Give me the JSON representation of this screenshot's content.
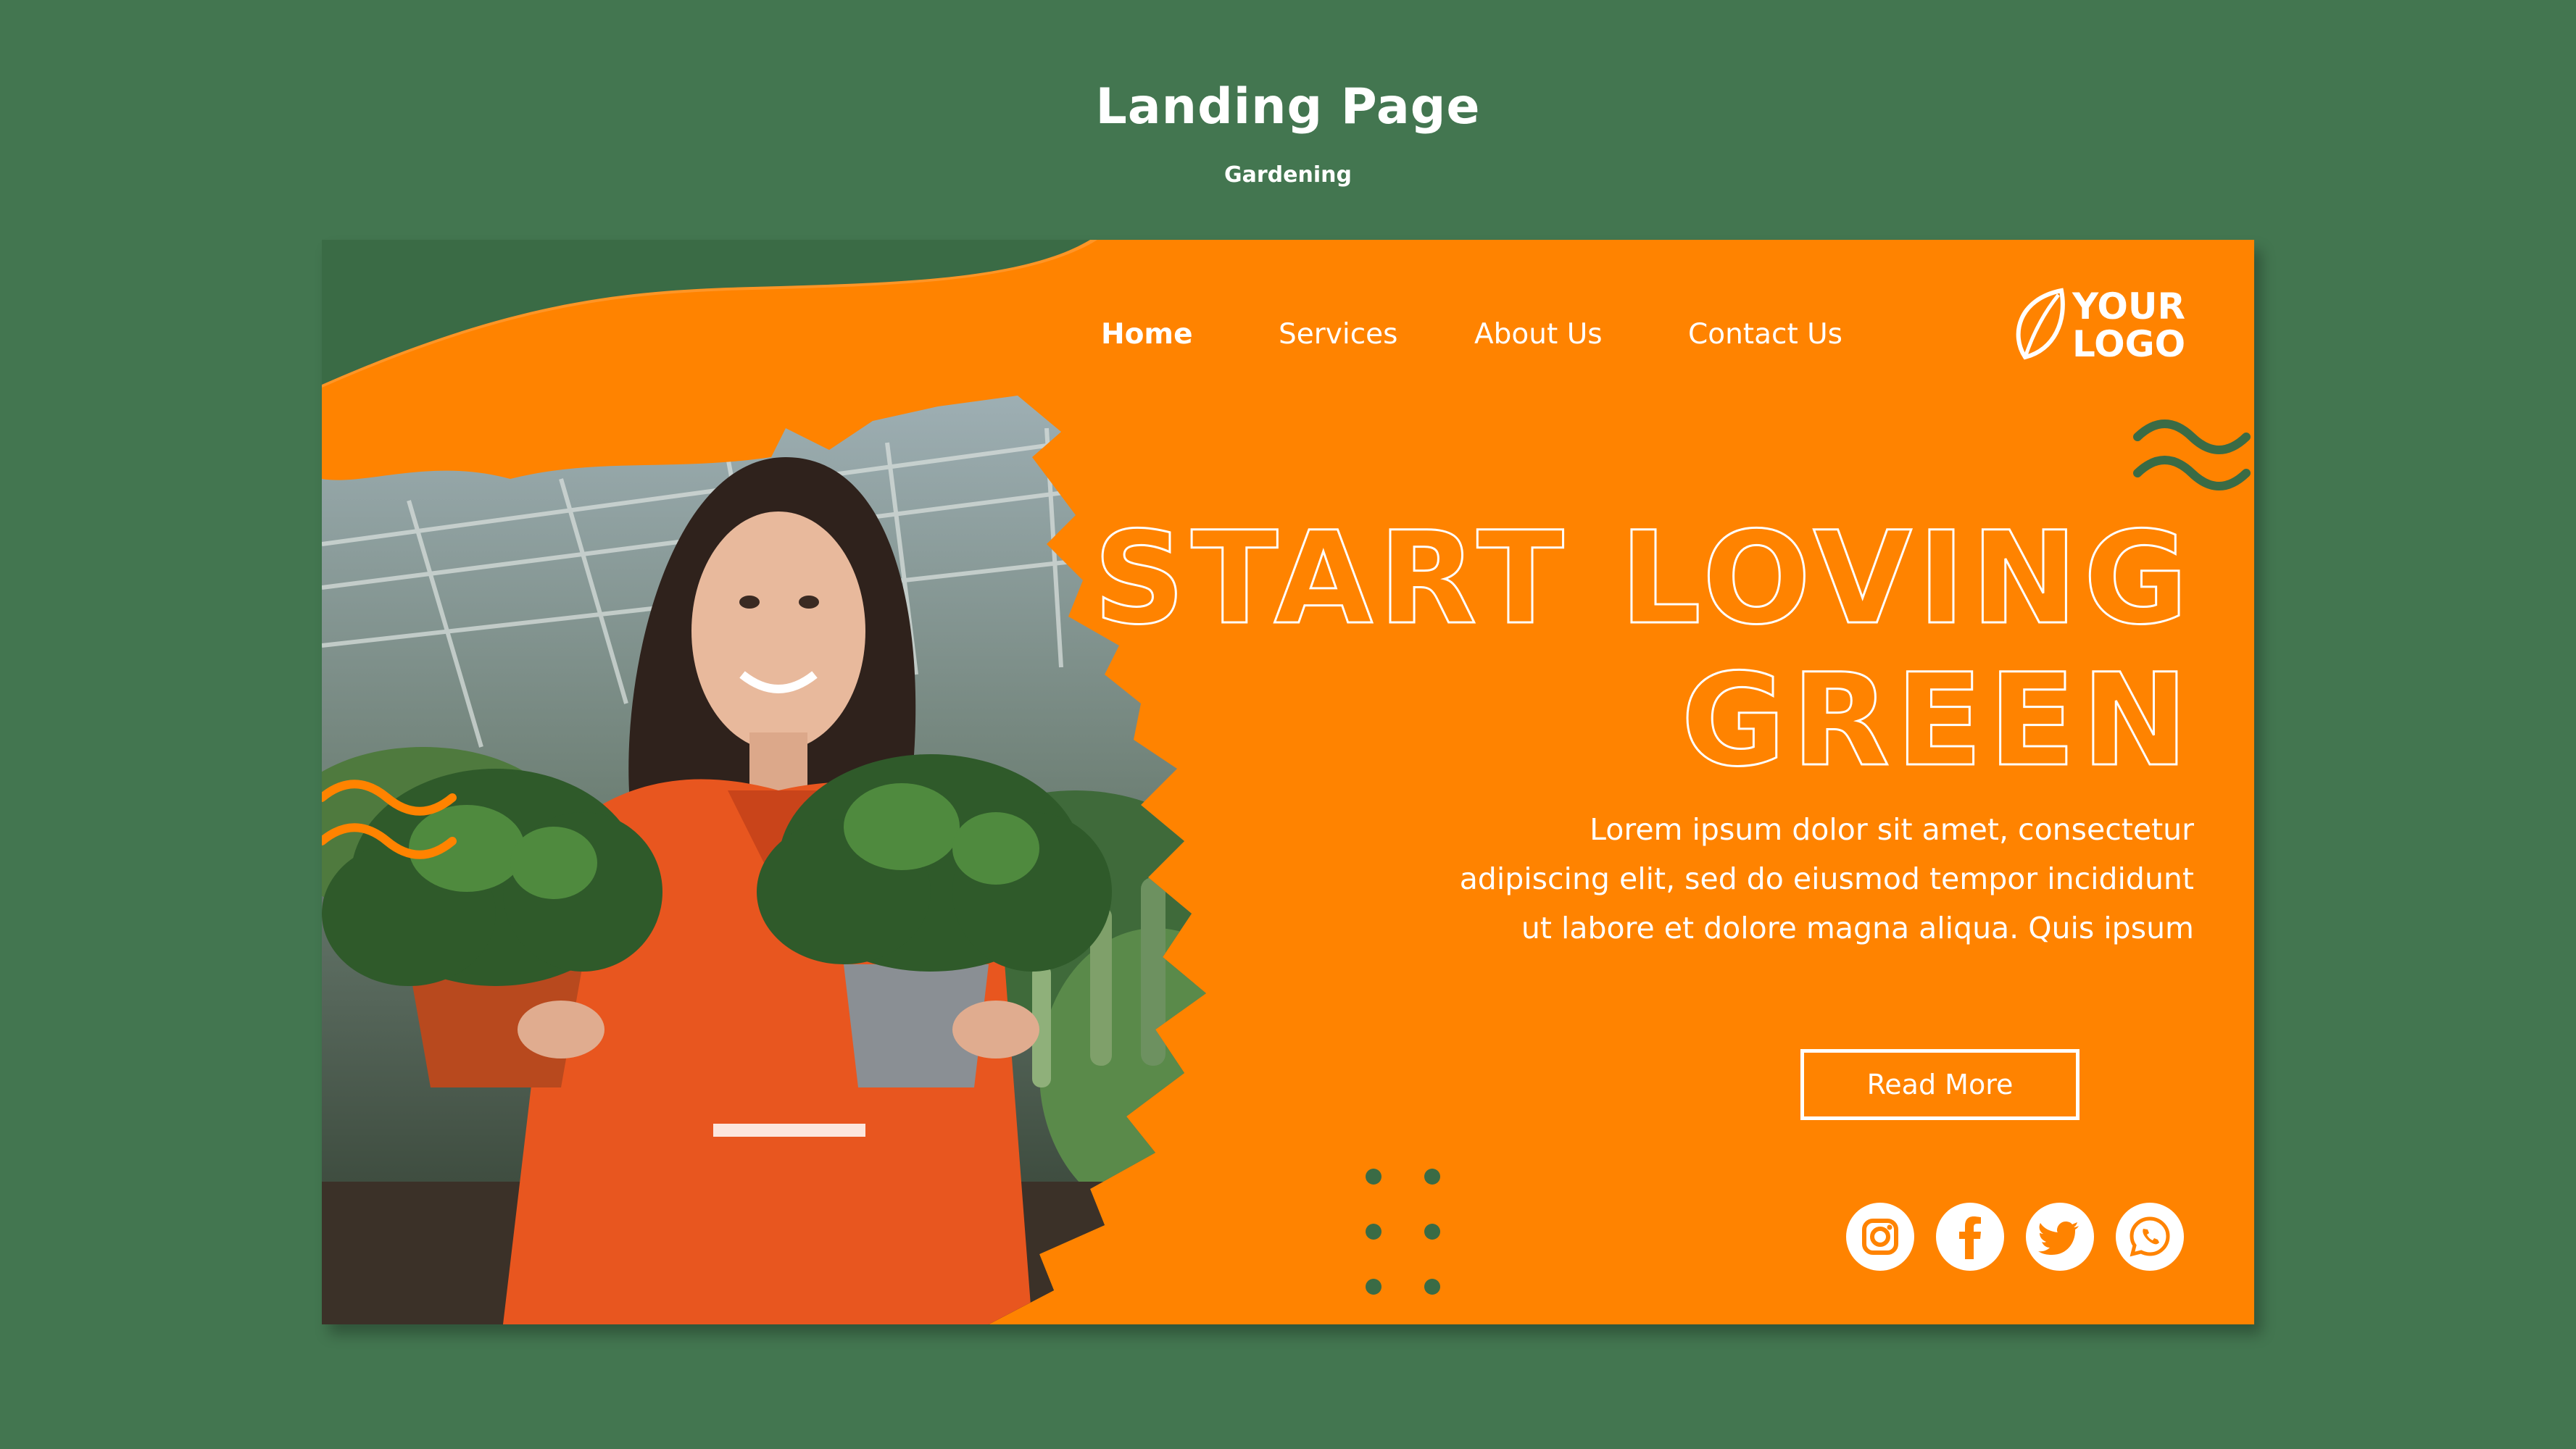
{
  "header": {
    "title": "Landing Page",
    "subtitle": "Gardening"
  },
  "nav": {
    "items": [
      {
        "label": "Home",
        "active": true
      },
      {
        "label": "Services",
        "active": false
      },
      {
        "label": "About Us",
        "active": false
      },
      {
        "label": "Contact Us",
        "active": false
      }
    ]
  },
  "logo": {
    "line1": "YOUR",
    "line2": "LOGO",
    "icon": "leaf-icon"
  },
  "hero": {
    "headline_line1": "START LOVING",
    "headline_line2": "GREEN",
    "body_line1": "Lorem ipsum dolor sit amet, consectetur",
    "body_line2": "adipiscing elit, sed do eiusmod tempor incididunt",
    "body_line3": "ut labore et dolore magna aliqua. Quis ipsum",
    "cta_label": "Read More"
  },
  "social": [
    {
      "icon": "instagram-icon"
    },
    {
      "icon": "facebook-icon"
    },
    {
      "icon": "twitter-icon"
    },
    {
      "icon": "whatsapp-icon"
    }
  ],
  "colors": {
    "background": "#437650",
    "accent": "#ff8300",
    "dark_green": "#3a6b45",
    "text": "#ffffff"
  }
}
